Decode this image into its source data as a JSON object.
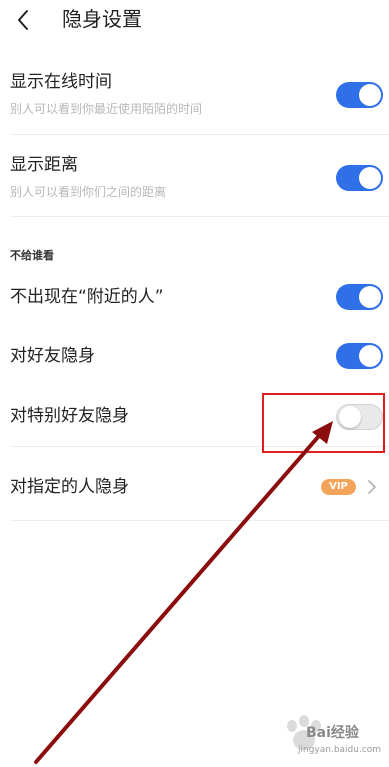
{
  "header": {
    "back_icon": "chevron-left-icon",
    "title": "隐身设置"
  },
  "settings": [
    {
      "title": "显示在线时间",
      "description": "别人可以看到你最近使用陌陌的时间",
      "toggle_on": true
    },
    {
      "title": "显示距离",
      "description": "别人可以看到你们之间的距离",
      "toggle_on": true
    }
  ],
  "hide_section": {
    "header": "不给谁看",
    "items": [
      {
        "title": "不出现在“附近的人”",
        "toggle_on": true
      },
      {
        "title": "对好友隐身",
        "toggle_on": true
      },
      {
        "title": "对特别好友隐身",
        "toggle_on": false
      },
      {
        "title": "对指定的人隐身",
        "badge": "VIP",
        "trailing_icon": "chevron-right-icon"
      }
    ]
  },
  "annotation": {
    "highlight_color": "#e02020",
    "arrow_color": "#8b0d0d"
  },
  "colors": {
    "toggle_on": "#2f6fe8",
    "toggle_off": "#e9e9e9",
    "vip_badge": "#f4a45a"
  },
  "watermark": {
    "brand": "Bai经验",
    "url": "jingyan.baidu.com"
  }
}
